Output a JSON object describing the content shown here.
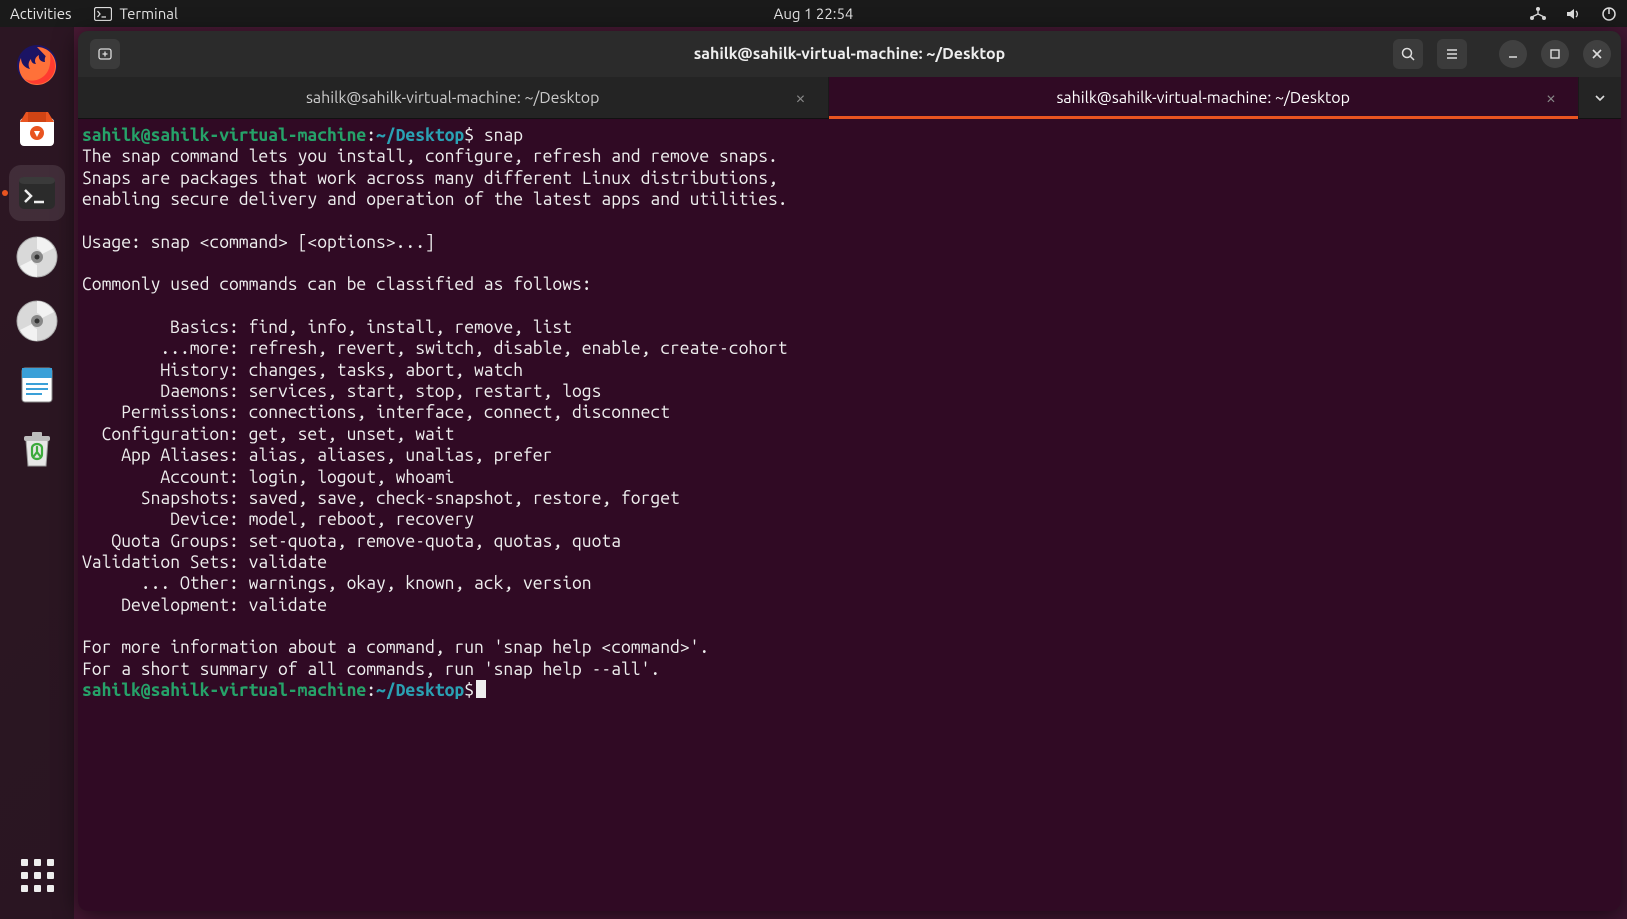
{
  "top_panel": {
    "activities": "Activities",
    "app": "Terminal",
    "clock": "Aug 1  22:54"
  },
  "window": {
    "title": "sahilk@sahilk-virtual-machine: ~/Desktop"
  },
  "tabs": {
    "0": {
      "label": "sahilk@sahilk-virtual-machine: ~/Desktop",
      "active": false
    },
    "1": {
      "label": "sahilk@sahilk-virtual-machine: ~/Desktop",
      "active": true
    }
  },
  "prompt": {
    "userhost": "sahilk@sahilk-virtual-machine",
    "colon": ":",
    "path": "~/Desktop",
    "dollar": "$"
  },
  "commands": {
    "0": "snap",
    "1": ""
  },
  "output": {
    "intro1": "The snap command lets you install, configure, refresh and remove snaps.",
    "intro2": "Snaps are packages that work across many different Linux distributions,",
    "intro3": "enabling secure delivery and operation of the latest apps and utilities.",
    "usage": "Usage: snap <command> [<options>...]",
    "classify": "Commonly used commands can be classified as follows:",
    "rows": {
      "basics": "         Basics: find, info, install, remove, list",
      "more": "        ...more: refresh, revert, switch, disable, enable, create-cohort",
      "history": "        History: changes, tasks, abort, watch",
      "daemons": "        Daemons: services, start, stop, restart, logs",
      "permissions": "    Permissions: connections, interface, connect, disconnect",
      "configuration": "  Configuration: get, set, unset, wait",
      "appaliases": "    App Aliases: alias, aliases, unalias, prefer",
      "account": "        Account: login, logout, whoami",
      "snapshots": "      Snapshots: saved, save, check-snapshot, restore, forget",
      "device": "         Device: model, reboot, recovery",
      "quota": "   Quota Groups: set-quota, remove-quota, quotas, quota",
      "validation": "Validation Sets: validate",
      "other": "      ... Other: warnings, okay, known, ack, version",
      "development": "    Development: validate"
    },
    "footer1": "For more information about a command, run 'snap help <command>'.",
    "footer2": "For a short summary of all commands, run 'snap help --all'."
  }
}
